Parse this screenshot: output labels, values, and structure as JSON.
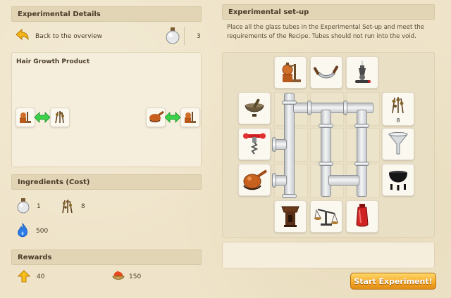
{
  "left": {
    "header": "Experimental Details",
    "back_label": "Back to the overview",
    "tube_count": "3",
    "recipe": {
      "title": "Hair Growth Product"
    },
    "ingredients": {
      "header": "Ingredients (Cost)",
      "items": [
        {
          "icon": "glass-flask-icon",
          "value": "1"
        },
        {
          "icon": "dried-herb-icon",
          "value": "8"
        },
        {
          "icon": "blue-flame-icon",
          "value": "500"
        }
      ]
    },
    "rewards": {
      "header": "Rewards",
      "items": [
        {
          "icon": "yellow-arrow-icon",
          "value": "40"
        },
        {
          "icon": "fire-bowl-icon",
          "value": "150"
        }
      ]
    }
  },
  "right": {
    "header": "Experimental set-up",
    "instructions": "Place all the glass tubes in the Experimental Set-up and meet the requirements of the Recipe. Tubes should not run into the void.",
    "herb_count": "8",
    "start_button": "Start Experiment!"
  },
  "colors": {
    "background": "#efe4c9",
    "header": "#e2d5b6",
    "button": "#f5a825",
    "arrow_green": "#3bd24a"
  }
}
